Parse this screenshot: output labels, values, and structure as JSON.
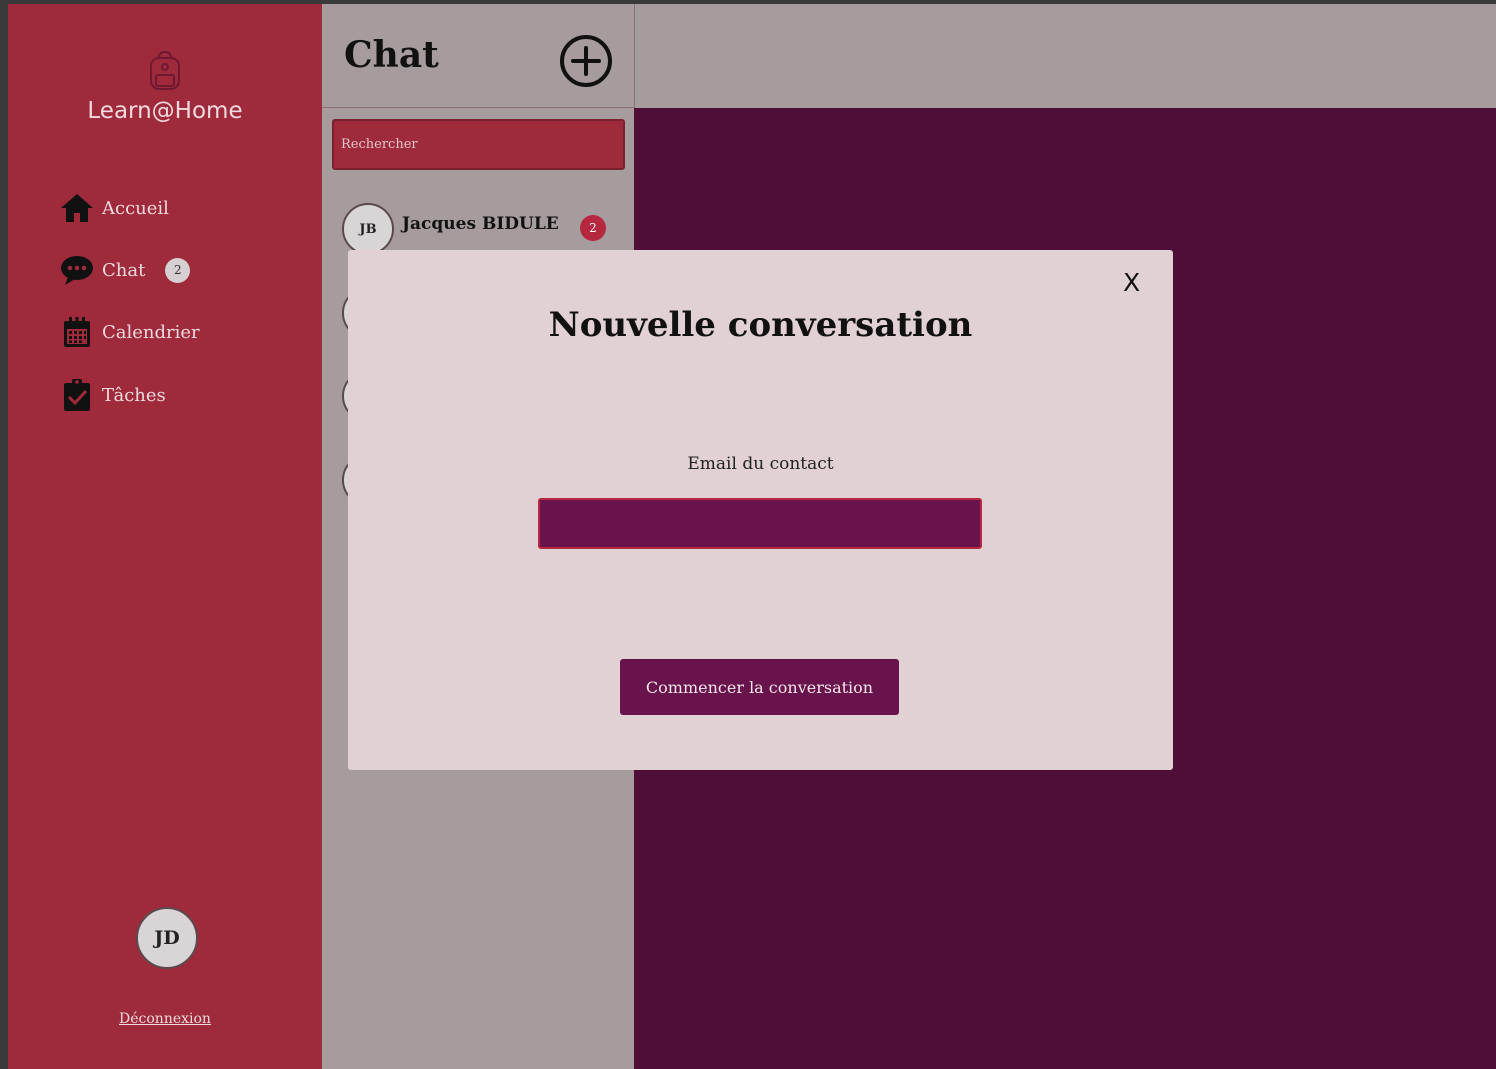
{
  "app": {
    "name": "Learn@Home"
  },
  "sidebar": {
    "items": [
      {
        "label": "Accueil",
        "icon": "home-icon"
      },
      {
        "label": "Chat",
        "icon": "chat-bubble-icon",
        "badge": "2"
      },
      {
        "label": "Calendrier",
        "icon": "calendar-icon"
      },
      {
        "label": "Tâches",
        "icon": "clipboard-check-icon"
      }
    ],
    "user_initials": "JD",
    "logout_label": "Déconnexion"
  },
  "chat_panel": {
    "title": "Chat",
    "add_icon": "plus-circle-icon",
    "search_placeholder": "Rechercher",
    "contacts": [
      {
        "initials": "JB",
        "name": "Jacques BIDULE",
        "unread": "2"
      }
    ]
  },
  "modal": {
    "close_label": "X",
    "title": "Nouvelle conversation",
    "email_label": "Email du contact",
    "email_value": "",
    "submit_label": "Commencer la conversation"
  },
  "colors": {
    "sidebar": "#9e2a3b",
    "panel": "#a69c9e",
    "conversation": "#4e0e37",
    "modal": "#e1d1d4",
    "accent": "#68134b",
    "badge": "#b5283f"
  }
}
